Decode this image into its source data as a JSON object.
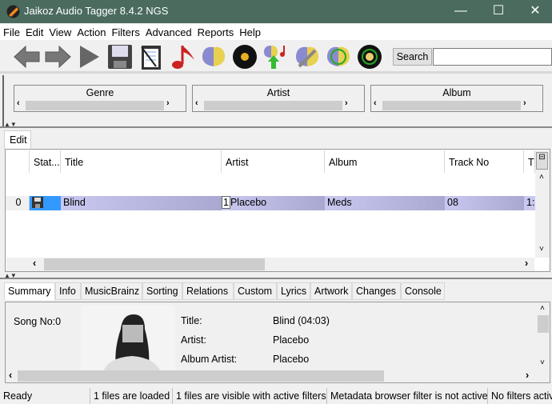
{
  "window": {
    "title": "Jaikoz Audio Tagger 8.4.2 NGS",
    "minimize": "—",
    "maximize": "☐",
    "close": "✕"
  },
  "menu": [
    "File",
    "Edit",
    "View",
    "Action",
    "Filters",
    "Advanced",
    "Reports",
    "Help"
  ],
  "toolbar": {
    "icons": [
      "back-arrow-icon",
      "forward-arrow-icon",
      "play-icon",
      "save-icon",
      "clipboard-icon",
      "music-note-icon",
      "brain-icon",
      "vinyl-record-icon",
      "brain-upload-icon",
      "brain-wrench-icon",
      "brain-sync-icon",
      "vinyl-sync-icon"
    ],
    "search_label": "Search",
    "search_value": ""
  },
  "browser": {
    "filters": [
      {
        "label": "Genre"
      },
      {
        "label": "Artist"
      },
      {
        "label": "Album"
      }
    ]
  },
  "edit_tab": "Edit",
  "table": {
    "columns": [
      "Stat...",
      "Title",
      "Artist",
      "Album",
      "Track No",
      "T"
    ],
    "rows": [
      {
        "index": "0",
        "title": "Blind",
        "artist_prefix": "1",
        "artist": "Placebo",
        "album": "Meds",
        "track": "08",
        "t": "1:"
      }
    ]
  },
  "bottom_tabs": [
    "Summary",
    "Info",
    "MusicBrainz",
    "Sorting",
    "Relations",
    "Custom",
    "Lyrics",
    "Artwork",
    "Changes",
    "Console"
  ],
  "summary": {
    "song_no": "Song No:0",
    "fields": [
      {
        "label": "Title:",
        "value": "Blind (04:03)"
      },
      {
        "label": "Artist:",
        "value": "Placebo"
      },
      {
        "label": "Album Artist:",
        "value": "Placebo"
      }
    ]
  },
  "status": [
    "Ready",
    "1 files are loaded",
    "1 files are visible with active filters",
    "Metadata browser filter is not active",
    "No filters activ"
  ],
  "colors": {
    "titlebar": "#4b6b5f",
    "row_selection": "#c4c4ec",
    "status_cell": "#3399ff"
  }
}
